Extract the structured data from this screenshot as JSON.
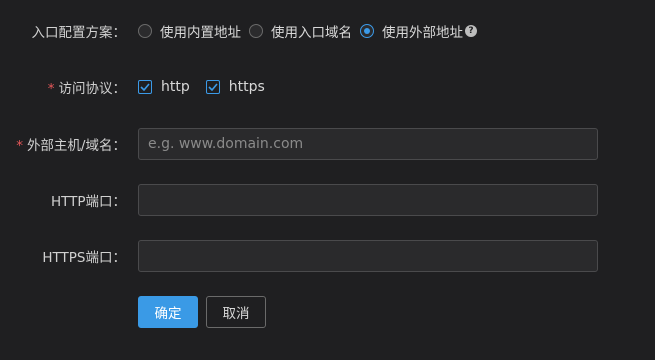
{
  "entry_scheme": {
    "label": "入口配置方案：",
    "options": [
      {
        "label": "使用内置地址",
        "checked": false
      },
      {
        "label": "使用入口域名",
        "checked": false
      },
      {
        "label": "使用外部地址",
        "checked": true
      }
    ],
    "help_icon": "question-circle-icon",
    "help_glyph": "?"
  },
  "protocol": {
    "required_mark": "*",
    "label": "访问协议：",
    "options": [
      {
        "label": "http",
        "checked": true
      },
      {
        "label": "https",
        "checked": true
      }
    ]
  },
  "external_host": {
    "required_mark": "*",
    "label": "外部主机/域名：",
    "value": "",
    "placeholder": "e.g. www.domain.com"
  },
  "http_port": {
    "label": "HTTP端口：",
    "value": "",
    "placeholder": ""
  },
  "https_port": {
    "label": "HTTPS端口：",
    "value": "",
    "placeholder": ""
  },
  "actions": {
    "confirm": "确定",
    "cancel": "取消"
  },
  "colors": {
    "accent": "#3a9ae6",
    "required": "#e8585a",
    "background": "#1f1f21"
  }
}
